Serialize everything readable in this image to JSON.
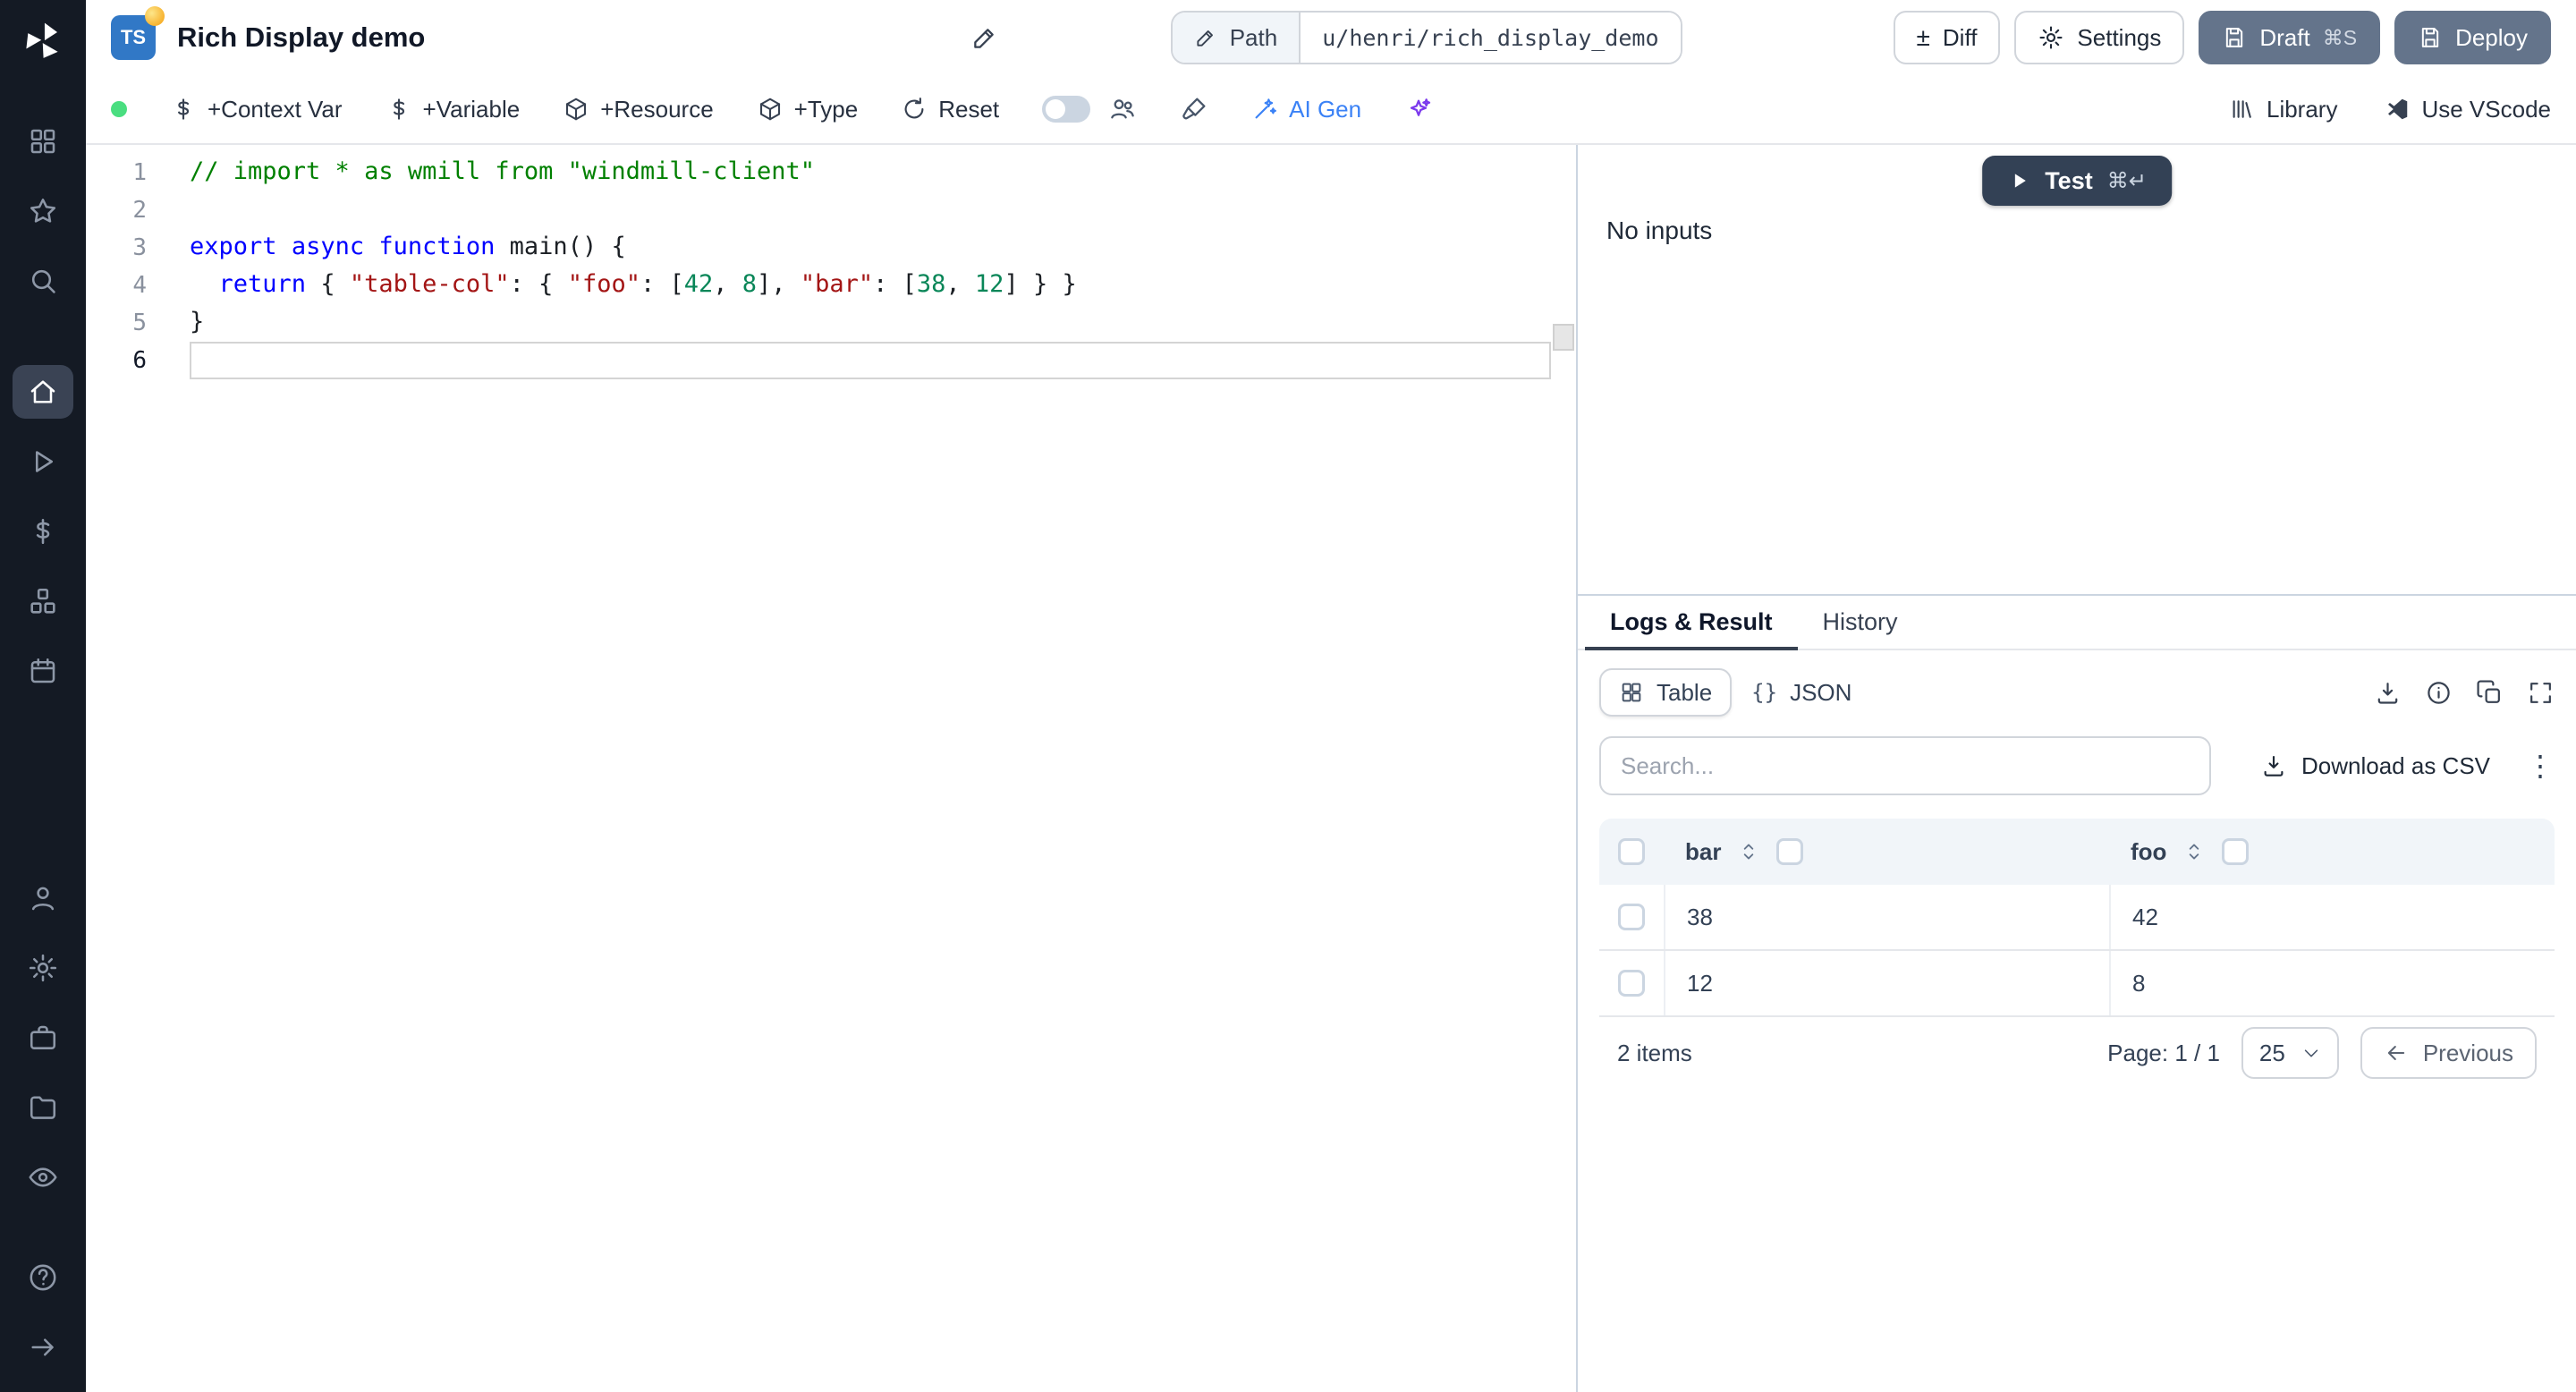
{
  "colors": {
    "sidebar_bg": "#141a24",
    "accent_blue": "#3b82f6",
    "slate_button": "#64748b",
    "dark_button": "#334155",
    "ts_badge_blue": "#3178c6",
    "status_green": "#4ade80",
    "ai_violet": "#7c3aed"
  },
  "sidebar": {
    "logo_icon": "windmill-logo",
    "active": "home",
    "groups": [
      [
        "apps",
        "star",
        "search"
      ],
      [
        "home",
        "play",
        "dollar",
        "blocks",
        "calendar"
      ],
      [
        "user",
        "gear",
        "briefcase",
        "folder",
        "eye"
      ],
      [
        "help",
        "arrow-right"
      ]
    ]
  },
  "header": {
    "lang_badge": "TS",
    "title": "Rich Display demo",
    "path_label": "Path",
    "path_value": "u/henri/rich_display_demo",
    "diff_icon_glyph": "±",
    "diff_label": "Diff",
    "settings_label": "Settings",
    "draft_label": "Draft",
    "draft_shortcut": "⌘S",
    "deploy_label": "Deploy"
  },
  "toolbar": {
    "context_var_label": "+Context Var",
    "variable_label": "+Variable",
    "resource_label": "+Resource",
    "type_label": "+Type",
    "reset_label": "Reset",
    "ai_gen_label": "AI Gen",
    "library_label": "Library",
    "use_vscode_label": "Use VScode"
  },
  "editor": {
    "lines": [
      {
        "num": "1",
        "tokens": [
          [
            "comment",
            "// import * as wmill from \"windmill-client\""
          ]
        ]
      },
      {
        "num": "2",
        "tokens": []
      },
      {
        "num": "3",
        "tokens": [
          [
            "kw",
            "export"
          ],
          [
            "plain",
            " "
          ],
          [
            "kw",
            "async"
          ],
          [
            "plain",
            " "
          ],
          [
            "kw",
            "function"
          ],
          [
            "plain",
            " main() {"
          ]
        ]
      },
      {
        "num": "4",
        "tokens": [
          [
            "plain",
            "  "
          ],
          [
            "kw",
            "return"
          ],
          [
            "plain",
            " { "
          ],
          [
            "str",
            "\"table-col\""
          ],
          [
            "plain",
            ": { "
          ],
          [
            "str",
            "\"foo\""
          ],
          [
            "plain",
            ": ["
          ],
          [
            "num",
            "42"
          ],
          [
            "plain",
            ", "
          ],
          [
            "num",
            "8"
          ],
          [
            "plain",
            "], "
          ],
          [
            "str",
            "\"bar\""
          ],
          [
            "plain",
            ": ["
          ],
          [
            "num",
            "38"
          ],
          [
            "plain",
            ", "
          ],
          [
            "num",
            "12"
          ],
          [
            "plain",
            "] } }"
          ]
        ]
      },
      {
        "num": "5",
        "tokens": [
          [
            "plain",
            "}"
          ]
        ]
      },
      {
        "num": "6",
        "tokens": [],
        "active": true
      }
    ]
  },
  "run_panel": {
    "test_label": "Test",
    "test_shortcut": "⌘↵",
    "no_inputs": "No inputs"
  },
  "result_panel": {
    "tabs": [
      {
        "label": "Logs & Result",
        "active": true
      },
      {
        "label": "History"
      }
    ],
    "view_toggle": {
      "table_label": "Table",
      "json_prefix": "{}",
      "json_label": "JSON"
    },
    "search_placeholder": "Search...",
    "download_csv_label": "Download as CSV",
    "more_options_glyph": "⋮",
    "table": {
      "columns": [
        "bar",
        "foo"
      ],
      "rows": [
        [
          "38",
          "42"
        ],
        [
          "12",
          "8"
        ]
      ],
      "items_label": "2 items",
      "page_label": "Page: 1 / 1",
      "page_size": "25",
      "previous_label": "Previous"
    }
  }
}
